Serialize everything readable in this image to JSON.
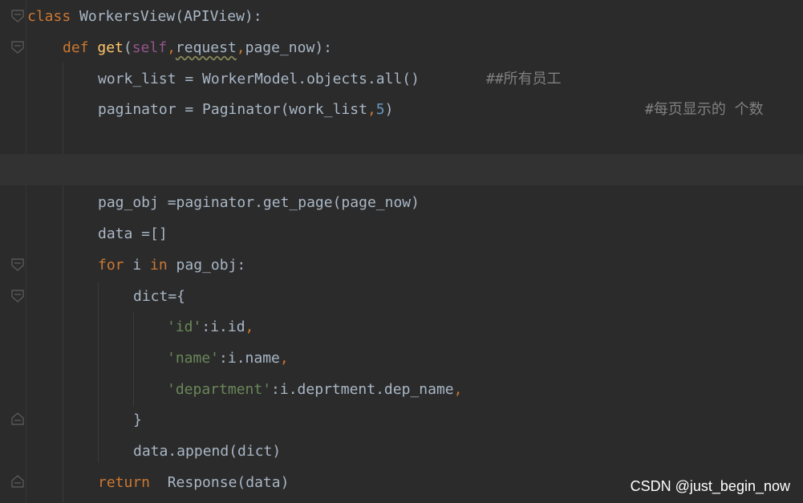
{
  "code": {
    "line1": {
      "kw": "class",
      "name": " WorkersView",
      "rest": "(APIView):"
    },
    "line2": {
      "kw": "def",
      "fn": " get",
      "open": "(",
      "self": "self",
      "comma1": ",",
      "param": "request",
      "comma2": ",",
      "rest": "page_now):"
    },
    "line3": {
      "code": "work_list = WorkerModel.objects.all()",
      "comment": "##所有员工"
    },
    "line4": {
      "code": "paginator = Paginator(work_list",
      "comma": ",",
      "num": "5",
      "close": ")",
      "comment": "#每页显示的 个数"
    },
    "line7": {
      "code": "pag_obj =paginator.get_page(page_now)"
    },
    "line8": {
      "code": "data =[]"
    },
    "line9": {
      "kw1": "for",
      "mid": " i ",
      "kw2": "in",
      "rest": " pag_obj:"
    },
    "line10": {
      "code": "dict={"
    },
    "line11": {
      "str": "'id'",
      "rest": ":i.id",
      "comma": ","
    },
    "line12": {
      "str": "'name'",
      "rest": ":i.name",
      "comma": ","
    },
    "line13": {
      "str": "'department'",
      "rest": ":i.deprtment.dep_name",
      "comma": ","
    },
    "line14": {
      "code": "}"
    },
    "line15": {
      "code": "data.append(dict)"
    },
    "line16": {
      "kw": "return",
      "rest": "  Response(data)"
    }
  },
  "watermark": "CSDN @just_begin_now",
  "colors": {
    "background": "#2b2b2b",
    "keyword": "#cc7832",
    "function": "#ffc66d",
    "self": "#94558d",
    "string": "#6a8759",
    "number": "#6897bb",
    "comment": "#808080",
    "text": "#a9b7c6"
  }
}
